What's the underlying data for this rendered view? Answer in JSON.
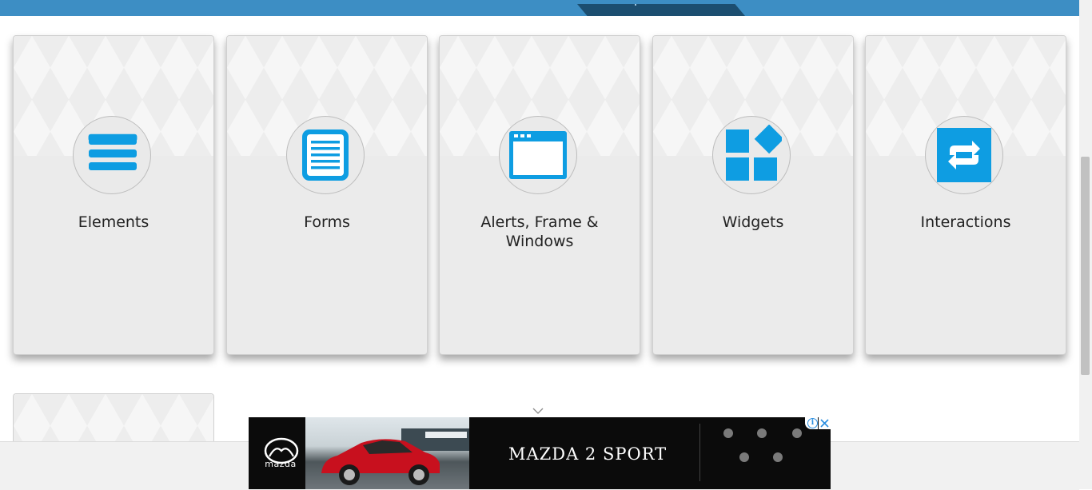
{
  "categories": [
    {
      "title": "Elements"
    },
    {
      "title": "Forms"
    },
    {
      "title": "Alerts, Frame & Windows"
    },
    {
      "title": "Widgets"
    },
    {
      "title": "Interactions"
    }
  ],
  "ad": {
    "brand": "mazda",
    "title": "MAZDA 2 SPORT",
    "info_icon": "i"
  },
  "colors": {
    "header": "#3d8ec4",
    "header_tab": "#1c4e70",
    "icon_blue": "#0e9de2",
    "card_bg": "#ebebeb"
  },
  "icons": [
    "list-lines-icon",
    "document-icon",
    "browser-window-icon",
    "widget-grid-icon",
    "refresh-arrows-icon"
  ]
}
